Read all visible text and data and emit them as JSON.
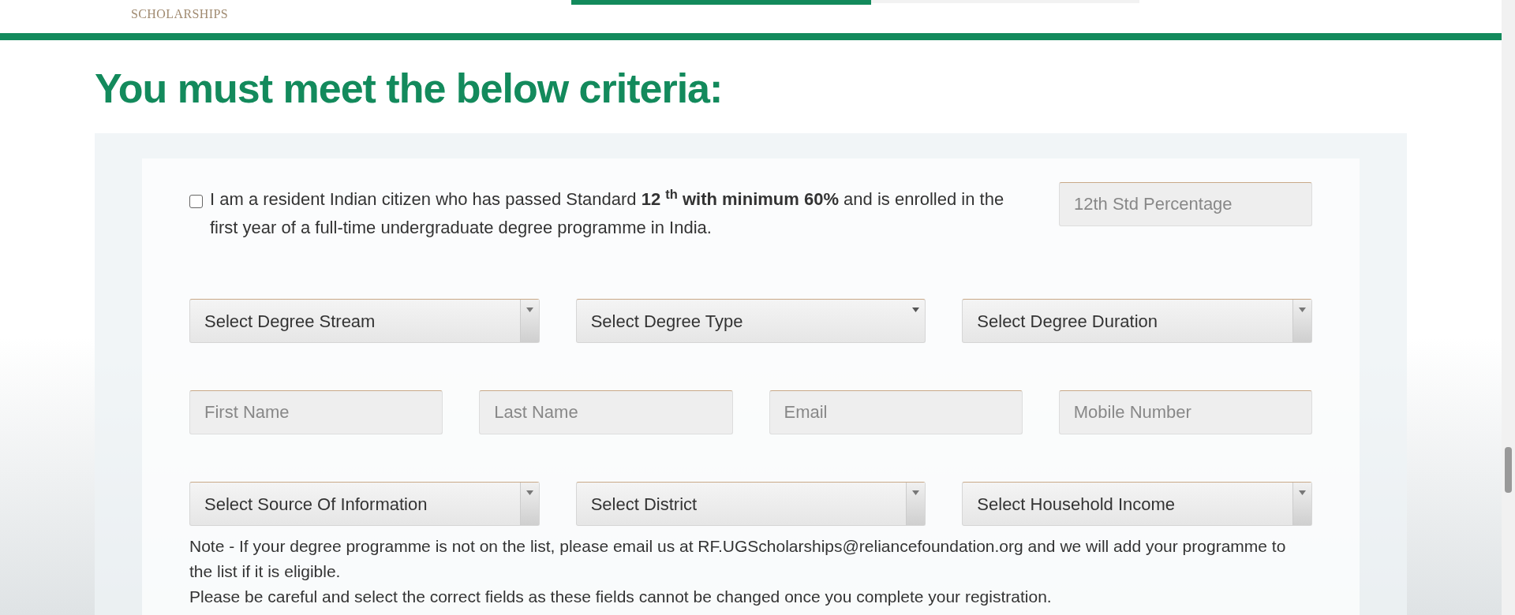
{
  "header": {
    "logo_text": "SCHOLARSHIPS"
  },
  "heading": "You must meet the below criteria:",
  "eligibility": {
    "checked": false,
    "text": "I am a resident Indian citizen who has passed Standard **12 $^{th}$ with minimum 60%** and is enrolled in the first year of a full-time undergraduate degree programme in India.",
    "percentage_placeholder": "12th Std Percentage"
  },
  "row_1": [
    {
      "label": "Select Degree Stream",
      "kind": "boxed"
    },
    {
      "label": "Select Degree Type",
      "kind": "plain"
    },
    {
      "label": "Select Degree Duration",
      "kind": "boxed"
    }
  ],
  "row_2": [
    {
      "placeholder": "First Name"
    },
    {
      "placeholder": "Last Name"
    },
    {
      "placeholder": "Email"
    },
    {
      "placeholder": "Mobile Number"
    }
  ],
  "row_3": [
    {
      "label": "Select Source Of Information",
      "kind": "boxed"
    },
    {
      "label": "Select District",
      "kind": "boxed"
    },
    {
      "label": "Select Household Income",
      "kind": "boxed"
    }
  ],
  "notes": [
    "Note - If your degree programme is not on the list, please email us at RF.UGScholarships@reliancefoundation.org and we will add your programme to the list if it is eligible.",
    "Please be careful and select the correct fields as these fields cannot be changed once you complete your registration."
  ]
}
